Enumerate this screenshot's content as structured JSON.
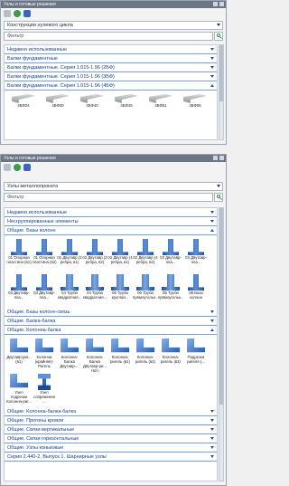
{
  "top_panel": {
    "title": "Узлы и готовые решения",
    "catalog": "Конструкции нулевого цикла",
    "filter_value": "Фильтр",
    "groups": [
      {
        "label": "Недавно использованные"
      },
      {
        "label": "Балки фундаментные"
      },
      {
        "label": "Балки фундаментные. Серия 1.015-1.96 (2БФ)"
      },
      {
        "label": "Балки фундаментные. Серия 1.015-1.96 (3БФ)"
      },
      {
        "label": "Балки фундаментные. Серия 1.015-1.96 (4БФ)"
      }
    ],
    "open_group": {
      "label": "Балки фундаментные. Серия 1.015-1.96 (4БФ)",
      "items": [
        "4БФ24",
        "4БФ30",
        "4БФ40",
        "4БФ45",
        "4БФ51",
        "4БФ55"
      ]
    }
  },
  "bottom_panel": {
    "title": "Узлы и готовые решения",
    "catalog": "Узлы металлопроката",
    "filter_value": "Фильтр",
    "top_groups": [
      {
        "label": "Недавно использованные"
      },
      {
        "label": "Несгруппированные элементы"
      }
    ],
    "group_bases": {
      "label": "Общие. Базы колонн",
      "items": [
        "01 Опорная пластина (в1)",
        "01 Опорная пластина (в2)",
        "02 Двутавр (2 ребра, в1)",
        "02 Двутавр (2 ребра, в2)",
        "02 Двутавр (4 ребра, в1)",
        "02 Двутавр (4 ребра, в2)",
        "03 Двутавр-пла...",
        "03 Двутавр-пла...",
        "03 Двутавр-пла...",
        "03 Двутавр-пла...",
        "04 Труба квадратная...",
        "04 Труба квадратная...",
        "05 Труба круглая...",
        "06 Труба прямоугольн...",
        "06 Труба прямоугольн...",
        "08 База колонн"
      ]
    },
    "middle_groups": [
      {
        "label": "Общие. Базы колонн-связь"
      },
      {
        "label": "Общие. Балка-балка"
      }
    ],
    "group_colbeam": {
      "label": "Общие. Колонна-балка",
      "items": [
        "Двутавр-риг... (в1)",
        "Колонна (крайняя)-Ригель",
        "Колонна-Балка Двутавр-...",
        "Колонна-Балка Двутавр-ри...(в2)",
        "Колонна-ригель (в1)",
        "Колонна-ригель (в2)",
        "Колонна-ригель (в3)"
      ],
      "items2": [
        "Подрезка ригеля (...",
        "Узел подрезки Колонна-риг...",
        "Узел сопряжения ..."
      ]
    },
    "bottom_groups": [
      {
        "label": "Общие. Колонна-балка-балка"
      },
      {
        "label": "Общие. Прогоны кровли"
      },
      {
        "label": "Общие. Связи вертикальные"
      },
      {
        "label": "Общие. Связи горизонтальные"
      },
      {
        "label": "Общие. Узлы коньковые"
      },
      {
        "label": "Серия 2.440-2. Выпуск 1. Шарнирные узлы"
      }
    ]
  },
  "colors": {
    "group_text": "#1a3f85",
    "group_line": "#7a9ed0",
    "titlebar": "#6a7686"
  }
}
